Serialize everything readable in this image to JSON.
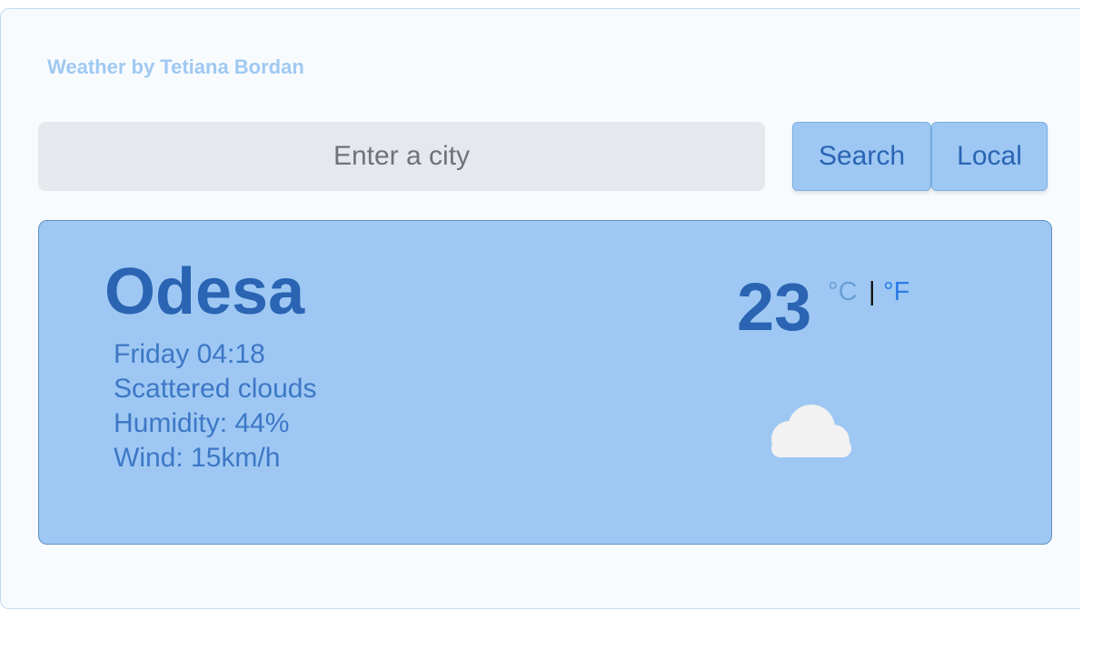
{
  "app": {
    "title": "Weather by Tetiana Bordan"
  },
  "search": {
    "placeholder": "Enter a city",
    "value": "",
    "search_label": "Search",
    "local_label": "Local"
  },
  "weather": {
    "city": "Odesa",
    "datetime": "Friday 04:18",
    "description": "Scattered clouds",
    "humidity": "Humidity: 44%",
    "wind": "Wind: 15km/h",
    "temperature": "23",
    "unit_celsius": "°C",
    "unit_separator": "|",
    "unit_fahrenheit": "°F",
    "icon": "cloud-icon"
  },
  "colors": {
    "card_background": "#9ec8f3",
    "primary_text": "#2a64b3",
    "app_title": "#9fc9f2",
    "fahrenheit_link": "#2b7ce6"
  }
}
